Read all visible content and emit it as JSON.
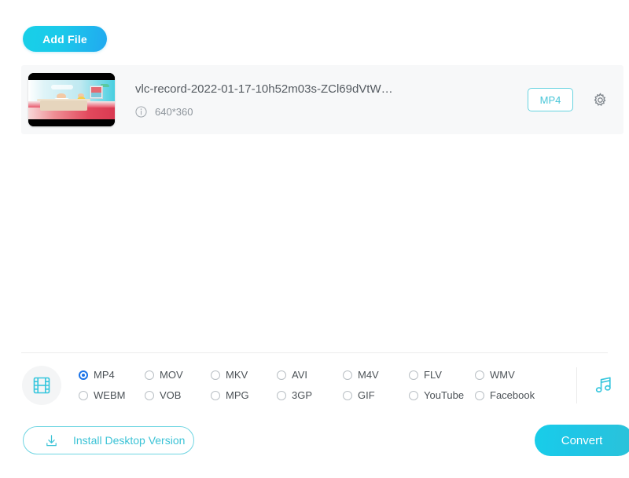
{
  "toolbar": {
    "add_file_label": "Add File"
  },
  "file_list": {
    "files": [
      {
        "name": "vlc-record-2022-01-17-10h52m03s-ZCl69dVtW…",
        "resolution": "640*360",
        "output_format": "MP4",
        "info_icon": "info-circle-icon",
        "settings_icon": "gear-icon",
        "thumbnail_icon": "video-thumbnail"
      }
    ]
  },
  "format_bar": {
    "media_type_icon": "film-strip-icon",
    "audio_icon": "music-note-icon",
    "selected_format": "MP4",
    "formats": [
      {
        "label": "MP4",
        "selected": true
      },
      {
        "label": "MOV",
        "selected": false
      },
      {
        "label": "MKV",
        "selected": false
      },
      {
        "label": "AVI",
        "selected": false
      },
      {
        "label": "M4V",
        "selected": false
      },
      {
        "label": "FLV",
        "selected": false
      },
      {
        "label": "WMV",
        "selected": false
      },
      {
        "label": "WEBM",
        "selected": false
      },
      {
        "label": "VOB",
        "selected": false
      },
      {
        "label": "MPG",
        "selected": false
      },
      {
        "label": "3GP",
        "selected": false
      },
      {
        "label": "GIF",
        "selected": false
      },
      {
        "label": "YouTube",
        "selected": false
      },
      {
        "label": "Facebook",
        "selected": false
      }
    ]
  },
  "bottom_bar": {
    "install_label": "Install Desktop Version",
    "install_icon": "download-icon",
    "convert_label": "Convert"
  },
  "colors": {
    "accent_cyan": "#1fc8e8",
    "accent_blue": "#21a9f0",
    "radio_selected": "#1a73e8",
    "row_background": "#f7f8f9",
    "text_primary": "#555b61",
    "text_secondary": "#8d949b"
  }
}
